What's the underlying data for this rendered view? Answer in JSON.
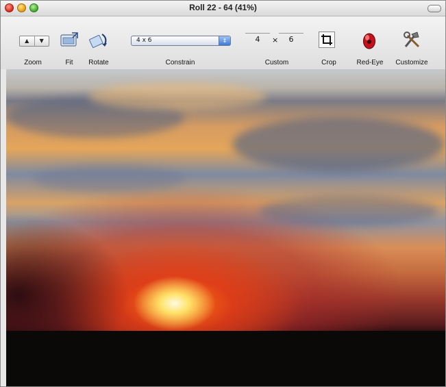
{
  "window": {
    "title": "Roll 22 - 64 (41%)",
    "traffic_lights": [
      "close",
      "minimize",
      "zoom"
    ]
  },
  "toolbar": {
    "zoom": {
      "label": "Zoom",
      "up": "▲",
      "down": "▼"
    },
    "fit": {
      "label": "Fit",
      "icon": "fit-window-icon"
    },
    "rotate": {
      "label": "Rotate",
      "icon": "rotate-icon"
    },
    "constrain": {
      "label": "Constrain",
      "selected": "4 x 6"
    },
    "custom": {
      "label": "Custom",
      "width": "4",
      "times": "×",
      "height": "6"
    },
    "crop": {
      "label": "Crop",
      "icon": "crop-icon"
    },
    "red_eye": {
      "label": "Red-Eye",
      "icon": "red-eye-icon"
    },
    "customize": {
      "label": "Customize",
      "icon": "tools-icon"
    }
  },
  "photo": {
    "subject": "sunset-photo"
  },
  "colors": {
    "sun": "#ffe26a",
    "sky_orange": "#e4a65a",
    "cloud_blue": "#7f8aa1",
    "ground": "#0b0808"
  }
}
